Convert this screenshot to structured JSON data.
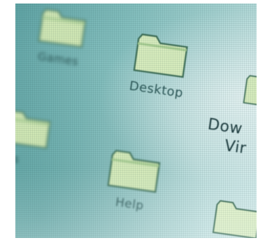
{
  "desktop": {
    "icons": [
      {
        "label": "Games"
      },
      {
        "label": "Desktop"
      },
      {
        "label": "Dow"
      },
      {
        "label": "Vir"
      },
      {
        "label": "ms"
      },
      {
        "label": "Help"
      }
    ]
  },
  "colors": {
    "screen": "#86c0bf",
    "folder_fill": "#cfe6b4",
    "folder_edge": "#4b7d65",
    "label": "#2f5a5a"
  }
}
